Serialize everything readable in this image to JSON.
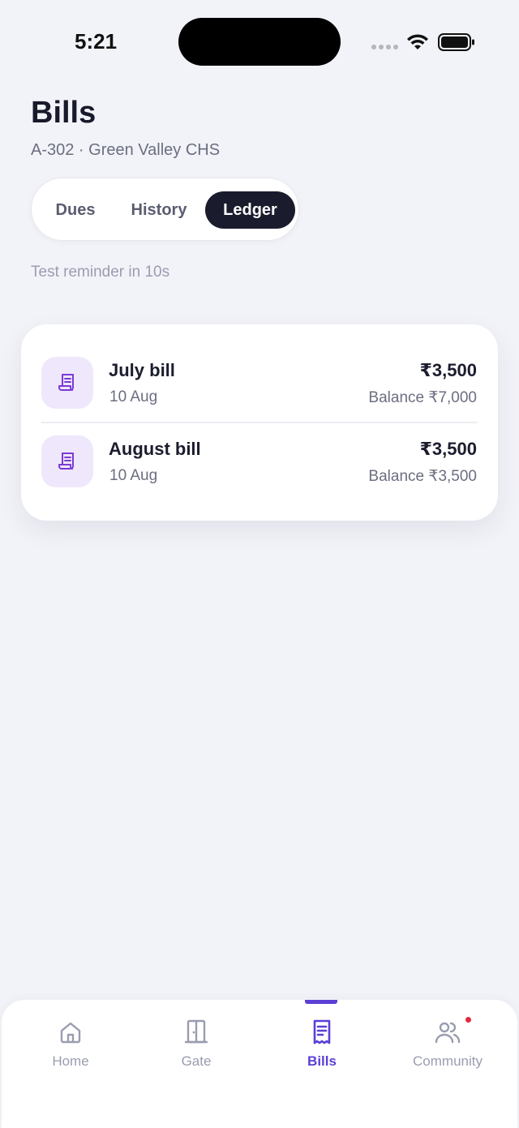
{
  "status_bar": {
    "time": "5:21"
  },
  "header": {
    "title": "Bills",
    "subtitle": "A-302 · Green Valley CHS"
  },
  "tabs": [
    {
      "label": "Dues",
      "active": false
    },
    {
      "label": "History",
      "active": false
    },
    {
      "label": "Ledger",
      "active": true
    }
  ],
  "reminder_text": "Test reminder in 10s",
  "ledger": [
    {
      "name": "July bill",
      "date": "10 Aug",
      "amount": "₹3,500",
      "balance": "Balance ₹7,000",
      "icon": "receipt-icon"
    },
    {
      "name": "August bill",
      "date": "10 Aug",
      "amount": "₹3,500",
      "balance": "Balance ₹3,500",
      "icon": "receipt-icon"
    }
  ],
  "bottom_nav": [
    {
      "label": "Home",
      "icon": "home-icon",
      "active": false
    },
    {
      "label": "Gate",
      "icon": "door-icon",
      "active": false
    },
    {
      "label": "Bills",
      "icon": "receipt-icon",
      "active": true
    },
    {
      "label": "Community",
      "icon": "users-icon",
      "active": false,
      "badge": true
    }
  ],
  "colors": {
    "accent": "#5b3fd6",
    "icon_purple": "#7a3ad6",
    "icon_bg": "#efe7fb",
    "dark": "#1a1b2d",
    "background": "#f2f3f8",
    "badge": "#e5283f"
  }
}
